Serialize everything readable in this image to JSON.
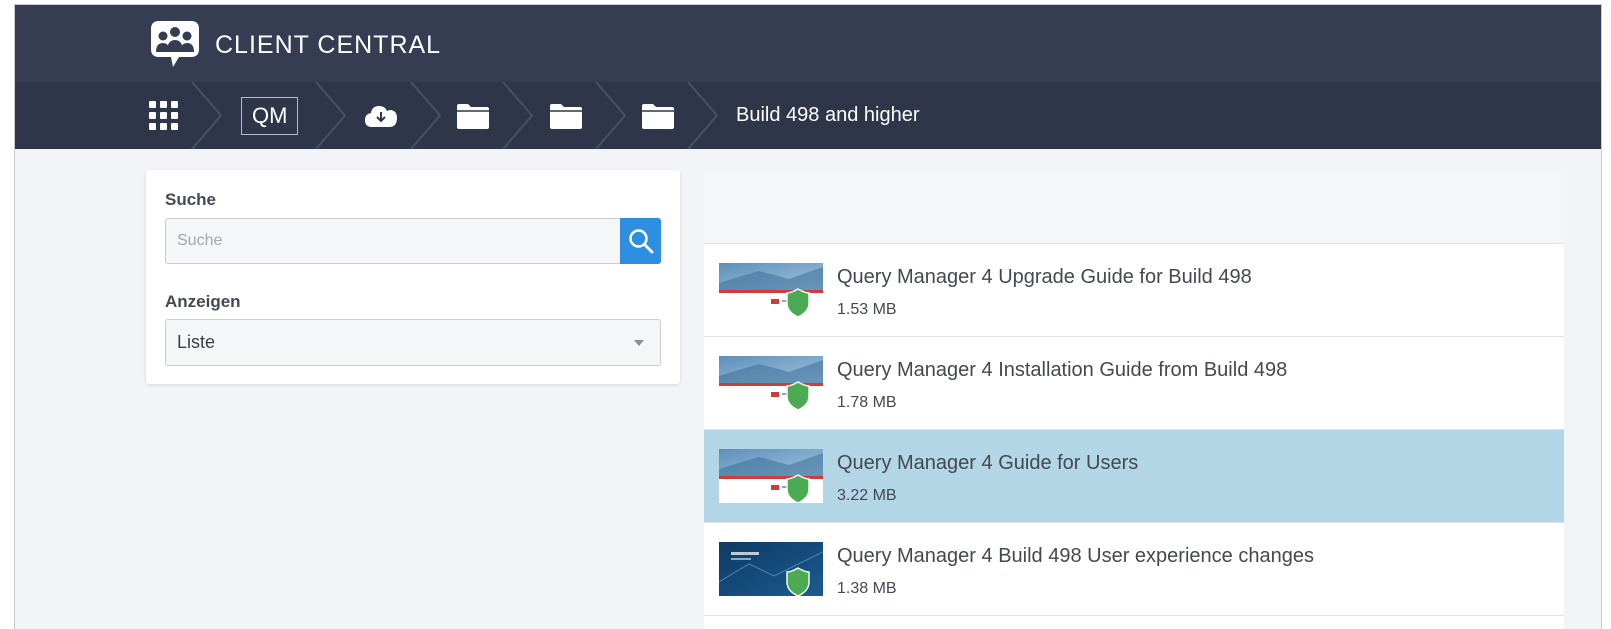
{
  "header": {
    "brand": "CLIENT CENTRAL",
    "logo_icon": "people-speech-bubble-icon"
  },
  "breadcrumb": {
    "apps_icon": "grid-apps-icon",
    "items": [
      {
        "type": "text-box",
        "label": "QM"
      },
      {
        "type": "icon",
        "icon": "cloud-download-icon"
      },
      {
        "type": "icon",
        "icon": "folder-icon"
      },
      {
        "type": "icon",
        "icon": "folder-icon"
      },
      {
        "type": "icon",
        "icon": "folder-icon"
      },
      {
        "type": "text",
        "label": "Build 498 and higher"
      }
    ]
  },
  "search": {
    "label": "Suche",
    "placeholder": "Suche",
    "button_icon": "search-icon"
  },
  "view": {
    "label": "Anzeigen",
    "selected": "Liste"
  },
  "files": [
    {
      "title": "Query Manager 4 Upgrade Guide for Build 498",
      "size": "1.53 MB",
      "selected": false
    },
    {
      "title": "Query Manager 4 Installation Guide from Build 498",
      "size": "1.78 MB",
      "selected": false
    },
    {
      "title": "Query Manager 4 Guide for Users",
      "size": "3.22 MB",
      "selected": true
    },
    {
      "title": "Query Manager 4 Build 498 User experience changes",
      "size": "1.38 MB",
      "selected": false
    }
  ],
  "colors": {
    "header": "#363d52",
    "breadcrumb_bar": "#2f3649",
    "accent": "#2e8fe0",
    "selected_row": "#b2d6e6",
    "shield": "#4caa53"
  }
}
